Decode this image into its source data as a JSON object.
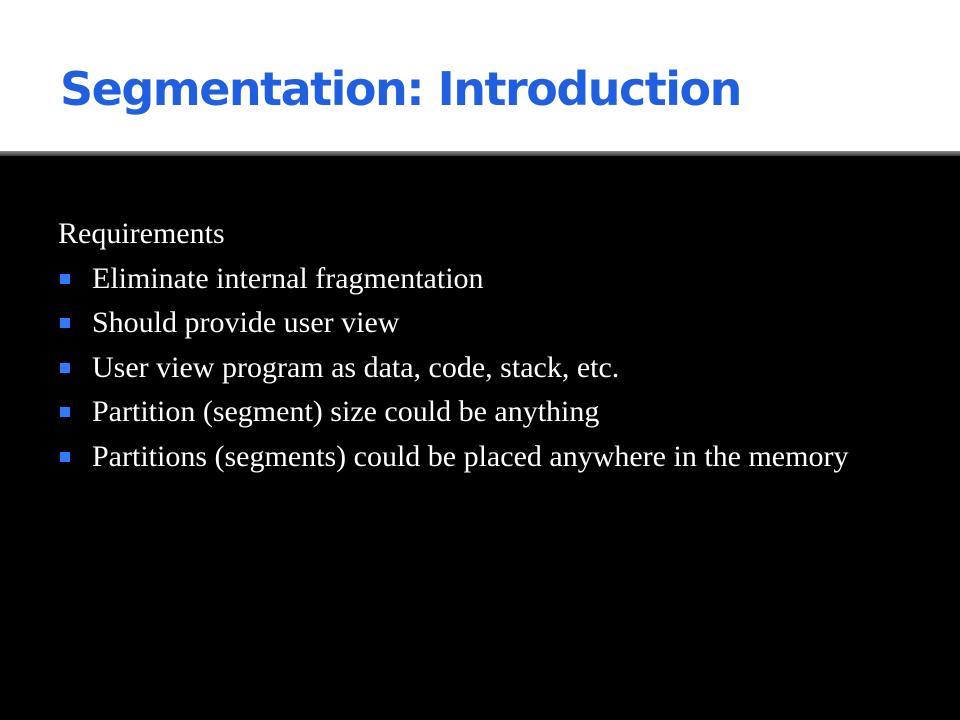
{
  "slide": {
    "title": "Segmentation: Introduction",
    "intro": "Requirements",
    "bullets": [
      "Eliminate internal fragmentation",
      "Should provide user view",
      "User view program as data, code, stack, etc.",
      "Partition (segment) size could be anything",
      "Partitions (segments) could be  placed anywhere in the memory"
    ]
  },
  "colors": {
    "title": "#1f5fe0",
    "title_background": "#ffffff",
    "background": "#000000",
    "text": "#ffffff",
    "bullet": "#2f7bff"
  },
  "icons": {
    "bullet": "square-bullet-icon"
  }
}
